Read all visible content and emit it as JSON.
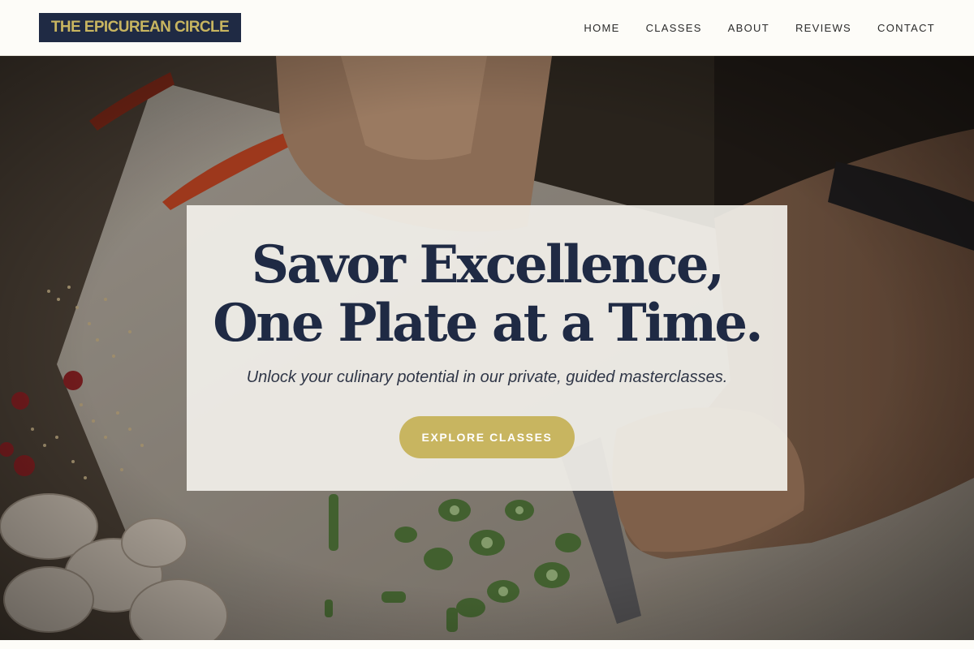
{
  "header": {
    "logo_text": "THE EPICUREAN CIRCLE",
    "nav": [
      {
        "label": "HOME"
      },
      {
        "label": "CLASSES"
      },
      {
        "label": "ABOUT"
      },
      {
        "label": "REVIEWS"
      },
      {
        "label": "CONTACT"
      }
    ]
  },
  "hero": {
    "title_line1": "Savor Excellence,",
    "title_line2": "One Plate at a Time.",
    "subtitle": "Unlock your culinary potential in our private, guided masterclasses.",
    "cta_label": "EXPLORE CLASSES",
    "background_icon": "chef-chopping-vegetables-photo"
  },
  "colors": {
    "navy": "#1f2a44",
    "gold": "#c8b560",
    "cream": "#fdfcf8"
  }
}
